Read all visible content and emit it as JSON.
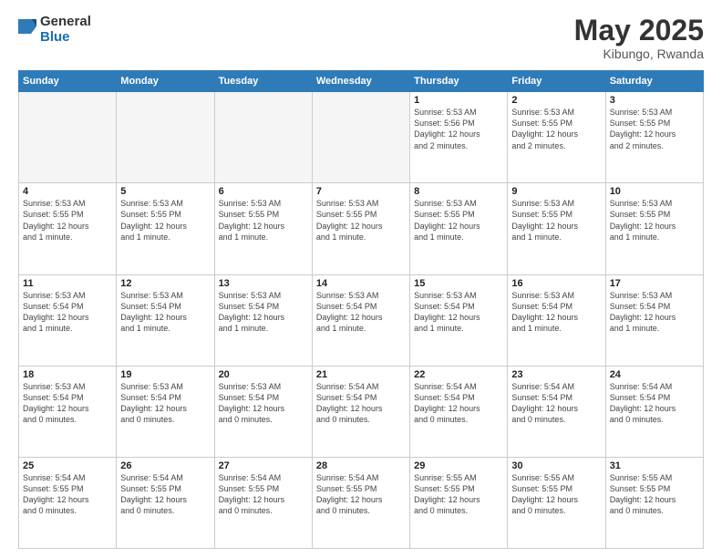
{
  "logo": {
    "general": "General",
    "blue": "Blue"
  },
  "title": "May 2025",
  "location": "Kibungo, Rwanda",
  "days_of_week": [
    "Sunday",
    "Monday",
    "Tuesday",
    "Wednesday",
    "Thursday",
    "Friday",
    "Saturday"
  ],
  "weeks": [
    [
      {
        "num": "",
        "info": ""
      },
      {
        "num": "",
        "info": ""
      },
      {
        "num": "",
        "info": ""
      },
      {
        "num": "",
        "info": ""
      },
      {
        "num": "1",
        "info": "Sunrise: 5:53 AM\nSunset: 5:56 PM\nDaylight: 12 hours\nand 2 minutes."
      },
      {
        "num": "2",
        "info": "Sunrise: 5:53 AM\nSunset: 5:55 PM\nDaylight: 12 hours\nand 2 minutes."
      },
      {
        "num": "3",
        "info": "Sunrise: 5:53 AM\nSunset: 5:55 PM\nDaylight: 12 hours\nand 2 minutes."
      }
    ],
    [
      {
        "num": "4",
        "info": "Sunrise: 5:53 AM\nSunset: 5:55 PM\nDaylight: 12 hours\nand 1 minute."
      },
      {
        "num": "5",
        "info": "Sunrise: 5:53 AM\nSunset: 5:55 PM\nDaylight: 12 hours\nand 1 minute."
      },
      {
        "num": "6",
        "info": "Sunrise: 5:53 AM\nSunset: 5:55 PM\nDaylight: 12 hours\nand 1 minute."
      },
      {
        "num": "7",
        "info": "Sunrise: 5:53 AM\nSunset: 5:55 PM\nDaylight: 12 hours\nand 1 minute."
      },
      {
        "num": "8",
        "info": "Sunrise: 5:53 AM\nSunset: 5:55 PM\nDaylight: 12 hours\nand 1 minute."
      },
      {
        "num": "9",
        "info": "Sunrise: 5:53 AM\nSunset: 5:55 PM\nDaylight: 12 hours\nand 1 minute."
      },
      {
        "num": "10",
        "info": "Sunrise: 5:53 AM\nSunset: 5:55 PM\nDaylight: 12 hours\nand 1 minute."
      }
    ],
    [
      {
        "num": "11",
        "info": "Sunrise: 5:53 AM\nSunset: 5:54 PM\nDaylight: 12 hours\nand 1 minute."
      },
      {
        "num": "12",
        "info": "Sunrise: 5:53 AM\nSunset: 5:54 PM\nDaylight: 12 hours\nand 1 minute."
      },
      {
        "num": "13",
        "info": "Sunrise: 5:53 AM\nSunset: 5:54 PM\nDaylight: 12 hours\nand 1 minute."
      },
      {
        "num": "14",
        "info": "Sunrise: 5:53 AM\nSunset: 5:54 PM\nDaylight: 12 hours\nand 1 minute."
      },
      {
        "num": "15",
        "info": "Sunrise: 5:53 AM\nSunset: 5:54 PM\nDaylight: 12 hours\nand 1 minute."
      },
      {
        "num": "16",
        "info": "Sunrise: 5:53 AM\nSunset: 5:54 PM\nDaylight: 12 hours\nand 1 minute."
      },
      {
        "num": "17",
        "info": "Sunrise: 5:53 AM\nSunset: 5:54 PM\nDaylight: 12 hours\nand 1 minute."
      }
    ],
    [
      {
        "num": "18",
        "info": "Sunrise: 5:53 AM\nSunset: 5:54 PM\nDaylight: 12 hours\nand 0 minutes."
      },
      {
        "num": "19",
        "info": "Sunrise: 5:53 AM\nSunset: 5:54 PM\nDaylight: 12 hours\nand 0 minutes."
      },
      {
        "num": "20",
        "info": "Sunrise: 5:53 AM\nSunset: 5:54 PM\nDaylight: 12 hours\nand 0 minutes."
      },
      {
        "num": "21",
        "info": "Sunrise: 5:54 AM\nSunset: 5:54 PM\nDaylight: 12 hours\nand 0 minutes."
      },
      {
        "num": "22",
        "info": "Sunrise: 5:54 AM\nSunset: 5:54 PM\nDaylight: 12 hours\nand 0 minutes."
      },
      {
        "num": "23",
        "info": "Sunrise: 5:54 AM\nSunset: 5:54 PM\nDaylight: 12 hours\nand 0 minutes."
      },
      {
        "num": "24",
        "info": "Sunrise: 5:54 AM\nSunset: 5:54 PM\nDaylight: 12 hours\nand 0 minutes."
      }
    ],
    [
      {
        "num": "25",
        "info": "Sunrise: 5:54 AM\nSunset: 5:55 PM\nDaylight: 12 hours\nand 0 minutes."
      },
      {
        "num": "26",
        "info": "Sunrise: 5:54 AM\nSunset: 5:55 PM\nDaylight: 12 hours\nand 0 minutes."
      },
      {
        "num": "27",
        "info": "Sunrise: 5:54 AM\nSunset: 5:55 PM\nDaylight: 12 hours\nand 0 minutes."
      },
      {
        "num": "28",
        "info": "Sunrise: 5:54 AM\nSunset: 5:55 PM\nDaylight: 12 hours\nand 0 minutes."
      },
      {
        "num": "29",
        "info": "Sunrise: 5:55 AM\nSunset: 5:55 PM\nDaylight: 12 hours\nand 0 minutes."
      },
      {
        "num": "30",
        "info": "Sunrise: 5:55 AM\nSunset: 5:55 PM\nDaylight: 12 hours\nand 0 minutes."
      },
      {
        "num": "31",
        "info": "Sunrise: 5:55 AM\nSunset: 5:55 PM\nDaylight: 12 hours\nand 0 minutes."
      }
    ]
  ]
}
